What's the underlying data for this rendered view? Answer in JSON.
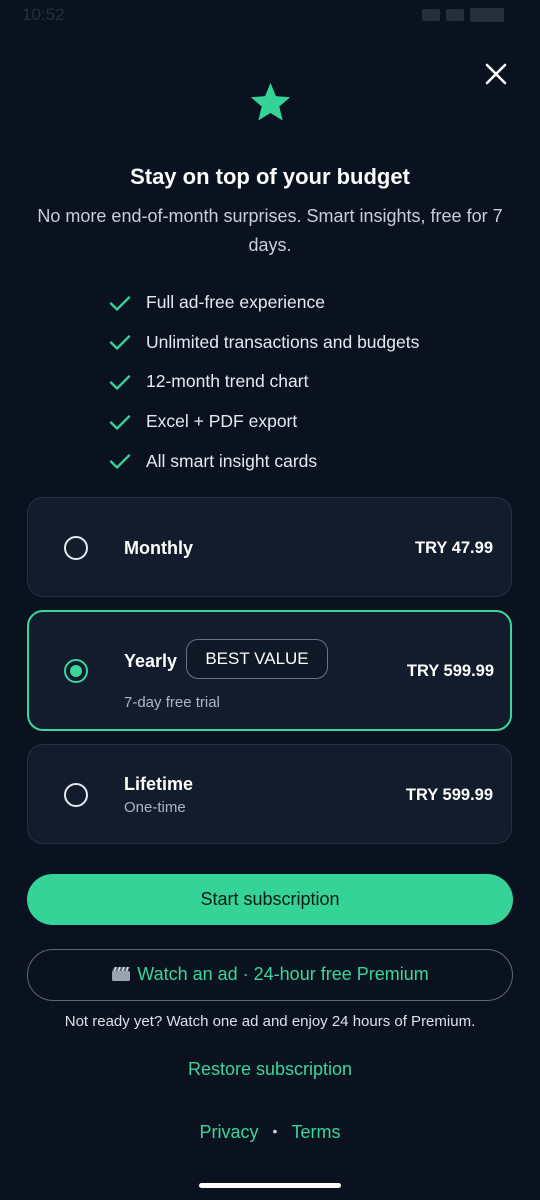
{
  "status_bar": {
    "time": "10:52"
  },
  "header": {
    "title": "Stay on top of your budget",
    "subtitle": "No more end-of-month surprises. Smart insights, free for 7 days."
  },
  "features": [
    "Full ad-free experience",
    "Unlimited transactions and budgets",
    "12-month trend chart",
    "Excel + PDF export",
    "All smart insight cards"
  ],
  "plans": [
    {
      "name": "Monthly",
      "subtitle": "",
      "price": "TRY 47.99",
      "badge": "",
      "selected": false
    },
    {
      "name": "Yearly",
      "subtitle": "7-day free trial",
      "price": "TRY 599.99",
      "badge": "BEST VALUE",
      "selected": true
    },
    {
      "name": "Lifetime",
      "subtitle": "One-time",
      "price": "TRY 599.99",
      "badge": "",
      "selected": false
    }
  ],
  "actions": {
    "primary": "Start subscription",
    "watch_ad": "Watch an ad · 24-hour free Premium",
    "ad_note": "Not ready yet? Watch one ad and enjoy 24 hours of Premium.",
    "restore": "Restore subscription"
  },
  "footer": {
    "privacy": "Privacy",
    "separator": "•",
    "terms": "Terms"
  },
  "colors": {
    "background": "#0a1220",
    "accent": "#36d399",
    "card": "#121c2d"
  }
}
